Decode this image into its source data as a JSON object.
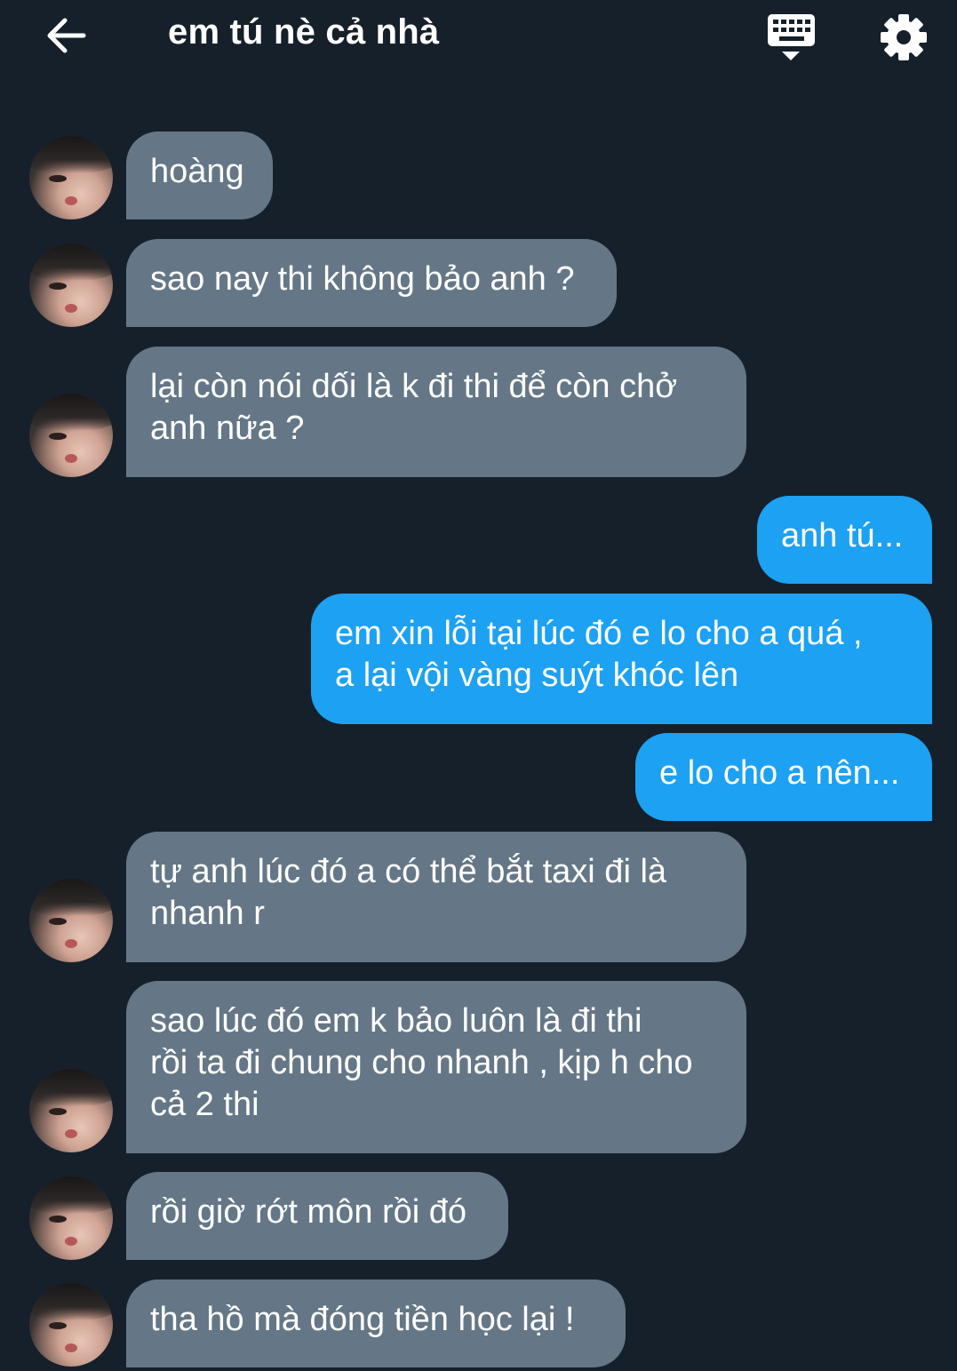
{
  "header": {
    "title": "em tú nè cả nhà",
    "back_icon": "arrow-left-icon",
    "keyboard_icon": "keyboard-icon",
    "settings_icon": "gear-icon"
  },
  "colors": {
    "background": "#15202b",
    "incoming_bubble": "#657786",
    "outgoing_bubble": "#1da1f2",
    "text": "#ffffff"
  },
  "messages": [
    {
      "direction": "incoming",
      "lines": [
        "hoàng"
      ]
    },
    {
      "direction": "incoming",
      "lines": [
        "sao nay thi không bảo anh ?"
      ]
    },
    {
      "direction": "incoming",
      "lines": [
        "lại còn nói dối là k đi thi để còn chở",
        "anh nữa ?"
      ]
    },
    {
      "direction": "outgoing",
      "lines": [
        "anh tú..."
      ]
    },
    {
      "direction": "outgoing",
      "lines": [
        "em xin lỗi tại lúc đó e lo cho a quá ,",
        "a lại vội vàng suýt khóc lên"
      ]
    },
    {
      "direction": "outgoing",
      "lines": [
        "e lo cho a nên..."
      ]
    },
    {
      "direction": "incoming",
      "lines": [
        "tự anh lúc đó a có thể bắt taxi đi là",
        "nhanh r"
      ]
    },
    {
      "direction": "incoming",
      "lines": [
        "sao lúc đó em k bảo luôn là đi thi",
        "rồi ta đi chung cho nhanh , kịp h cho",
        "cả 2 thi"
      ]
    },
    {
      "direction": "incoming",
      "lines": [
        "rồi giờ rớt môn rồi đó"
      ]
    },
    {
      "direction": "incoming",
      "lines": [
        "tha hồ mà đóng tiền học lại !"
      ]
    }
  ]
}
